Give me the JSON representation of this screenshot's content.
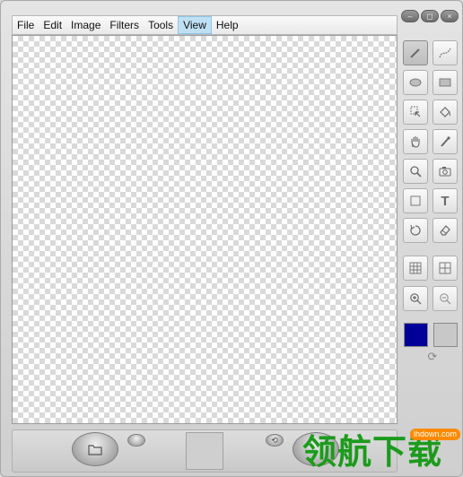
{
  "menu": {
    "items": [
      {
        "label": "File",
        "active": false
      },
      {
        "label": "Edit",
        "active": false
      },
      {
        "label": "Image",
        "active": false
      },
      {
        "label": "Filters",
        "active": false
      },
      {
        "label": "Tools",
        "active": false
      },
      {
        "label": "View",
        "active": true
      },
      {
        "label": "Help",
        "active": false
      }
    ]
  },
  "window_controls": {
    "minimize": "–",
    "restore": "◻",
    "close": "×"
  },
  "tools": [
    {
      "name": "pencil-tool",
      "icon": "pencil-icon",
      "selected": true
    },
    {
      "name": "curve-tool",
      "icon": "curve-icon",
      "selected": false
    },
    {
      "name": "ellipse-tool",
      "icon": "ellipse-icon",
      "selected": false
    },
    {
      "name": "rectangle-tool",
      "icon": "rectangle-icon",
      "selected": false
    },
    {
      "name": "select-tool",
      "icon": "select-icon",
      "selected": false
    },
    {
      "name": "fill-tool",
      "icon": "paint-bucket-icon",
      "selected": false
    },
    {
      "name": "hand-tool",
      "icon": "hand-icon",
      "selected": false
    },
    {
      "name": "dropper-tool",
      "icon": "eyedropper-icon",
      "selected": false
    },
    {
      "name": "zoom-tool",
      "icon": "magnifier-icon",
      "selected": false
    },
    {
      "name": "camera-tool",
      "icon": "camera-icon",
      "selected": false
    },
    {
      "name": "marquee-tool",
      "icon": "marquee-icon",
      "selected": false
    },
    {
      "name": "text-tool",
      "icon": "text-icon",
      "selected": false
    },
    {
      "name": "rotate-tool",
      "icon": "rotate-icon",
      "selected": false
    },
    {
      "name": "eraser-tool",
      "icon": "eraser-icon",
      "selected": false
    },
    {
      "name": "grid-tool",
      "icon": "grid-icon",
      "selected": false
    },
    {
      "name": "guides-tool",
      "icon": "guides-icon",
      "selected": false
    },
    {
      "name": "zoom-in-tool",
      "icon": "zoom-in-icon",
      "selected": false
    },
    {
      "name": "zoom-out-tool",
      "icon": "zoom-out-icon",
      "selected": false
    }
  ],
  "text_tool_label": "T",
  "colors": {
    "foreground": "#000099",
    "background": "#c8c8c8",
    "accent": "#bfe0f3"
  },
  "watermark": {
    "main": "领航下载",
    "sub": "lhdown.com"
  }
}
